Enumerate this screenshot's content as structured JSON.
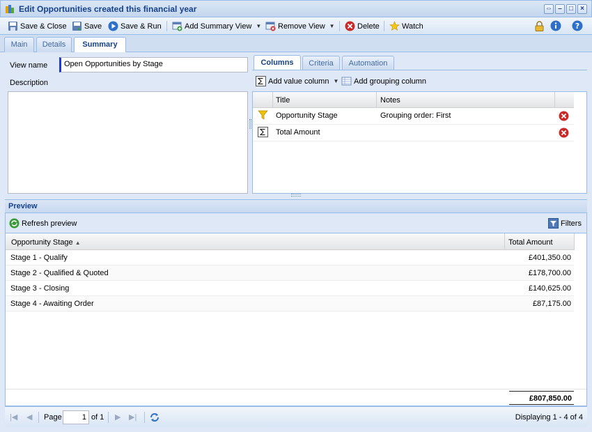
{
  "window": {
    "title": "Edit Opportunities created this financial year"
  },
  "toolbar": {
    "save_close": "Save & Close",
    "save": "Save",
    "save_run": "Save & Run",
    "add_summary_view": "Add Summary View",
    "remove_view": "Remove View",
    "delete": "Delete",
    "watch": "Watch"
  },
  "tabs": [
    "Main",
    "Details",
    "Summary"
  ],
  "form": {
    "view_name_label": "View name",
    "view_name_value": "Open Opportunities by Stage",
    "description_label": "Description",
    "description_value": ""
  },
  "subtabs": [
    "Columns",
    "Criteria",
    "Automation"
  ],
  "columns_toolbar": {
    "add_value_column": "Add value column",
    "add_grouping_column": "Add grouping column"
  },
  "columns_grid": {
    "headers": [
      "Title",
      "Notes"
    ],
    "rows": [
      {
        "icon": "funnel-icon",
        "title": "Opportunity Stage",
        "notes": "Grouping order: First"
      },
      {
        "icon": "sigma-icon",
        "title": "Total Amount",
        "notes": ""
      }
    ]
  },
  "preview": {
    "title": "Preview",
    "refresh": "Refresh preview",
    "filters": "Filters",
    "headers": [
      "Opportunity Stage",
      "Total Amount"
    ],
    "rows": [
      {
        "stage": "Stage 1 - Qualify",
        "amount": "£401,350.00"
      },
      {
        "stage": "Stage 2 - Qualified & Quoted",
        "amount": "£178,700.00"
      },
      {
        "stage": "Stage 3 - Closing",
        "amount": "£140,625.00"
      },
      {
        "stage": "Stage 4 - Awaiting Order",
        "amount": "£87,175.00"
      }
    ],
    "total": "£807,850.00"
  },
  "pager": {
    "page_label": "Page",
    "page_value": "1",
    "of_label": "of 1",
    "displaying": "Displaying 1 - 4 of 4"
  }
}
